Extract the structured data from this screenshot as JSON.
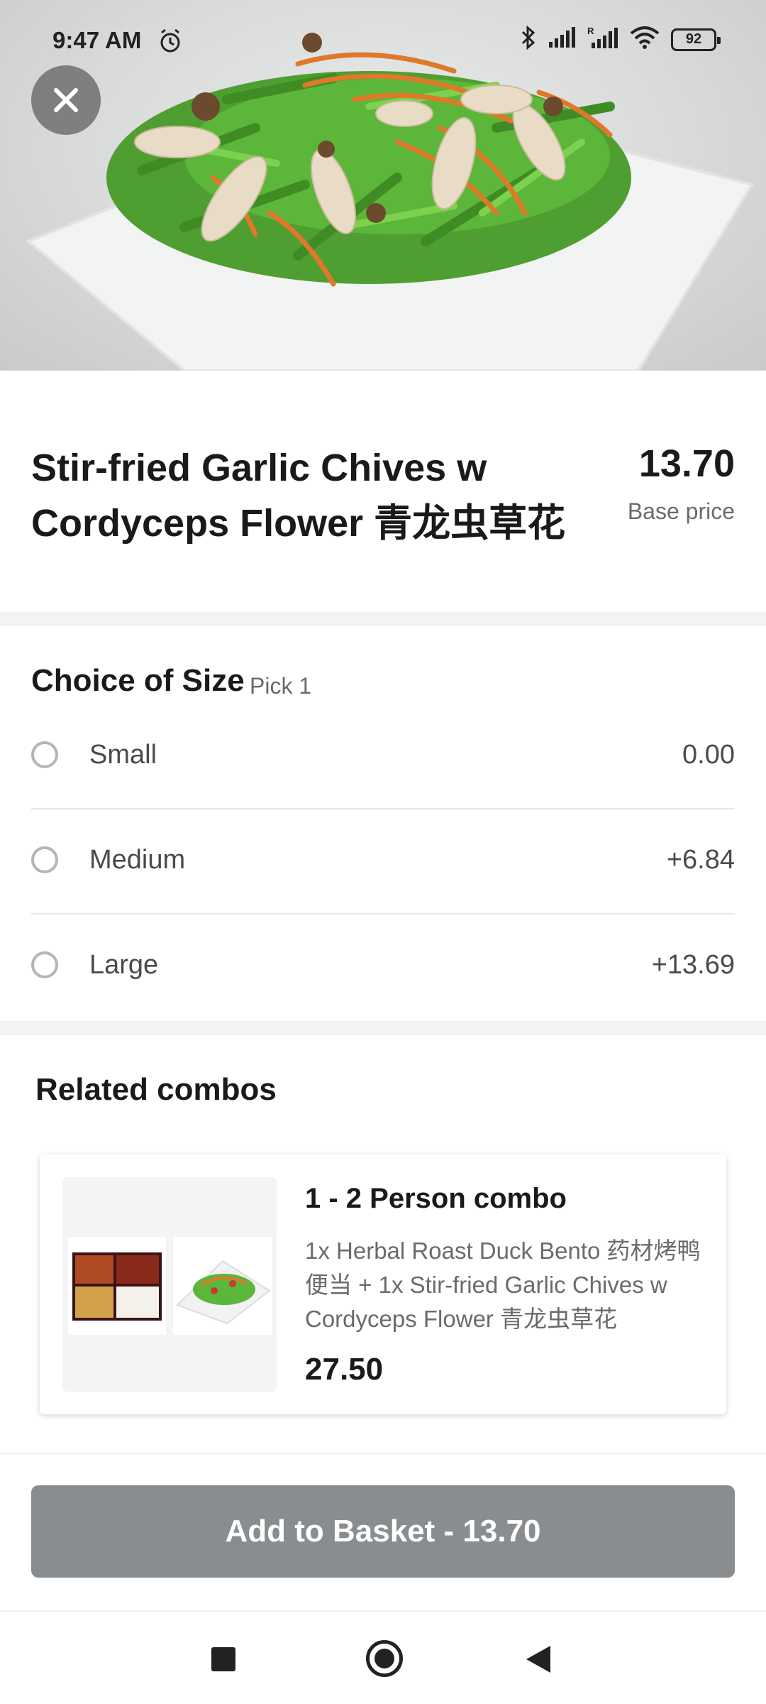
{
  "status_bar": {
    "time": "9:47 AM",
    "battery": "92",
    "icons": [
      "alarm-icon",
      "bluetooth-icon",
      "signal-icon",
      "signal-roaming-icon",
      "wifi-icon",
      "battery-icon"
    ]
  },
  "hero": {
    "close_icon": "close-icon"
  },
  "item": {
    "name": "Stir-fried Garlic Chives w Cordyceps Flower 青龙虫草花",
    "price": "13.70",
    "base_price_label": "Base price"
  },
  "size": {
    "title": "Choice of Size",
    "pick_label": "Pick 1",
    "options": [
      {
        "label": "Small",
        "price": "0.00"
      },
      {
        "label": "Medium",
        "price": "+6.84"
      },
      {
        "label": "Large",
        "price": "+13.69"
      }
    ]
  },
  "combos": {
    "heading": "Related combos",
    "items": [
      {
        "name": "1 - 2 Person combo",
        "description": "1x Herbal Roast Duck Bento 药材烤鸭便当 + 1x Stir-fried Garlic Chives w Cordyceps Flower 青龙虫草花",
        "price": "27.50"
      }
    ]
  },
  "cta": {
    "label": "Add to Basket - 13.70"
  },
  "nav": {
    "icons": [
      "recents-icon",
      "home-icon",
      "back-icon"
    ]
  },
  "colors": {
    "button_disabled": "#8a8d90",
    "divider": "#f3f3f3",
    "radio": "#b5b5b5"
  }
}
